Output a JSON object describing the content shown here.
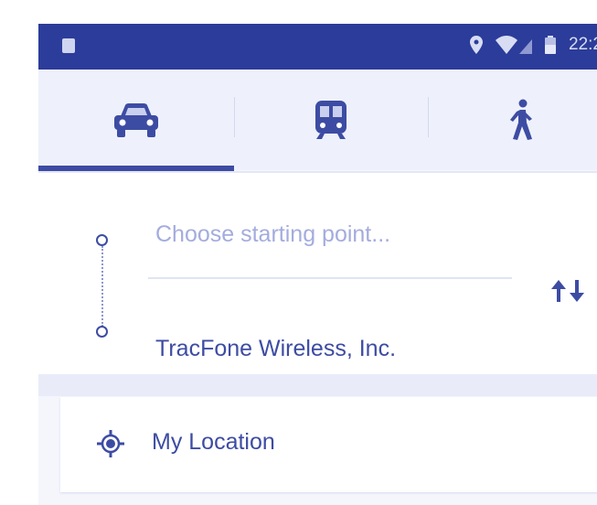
{
  "colors": {
    "accent": "#3d4ca3",
    "status_bar": "#2c3c9a",
    "placeholder": "#a4acde",
    "panel_bg": "#f4f6fc"
  },
  "status_bar": {
    "left_icon": "notification-image-icon",
    "icons": [
      "location-pin-icon",
      "wifi-icon",
      "signal-icon",
      "battery-icon"
    ],
    "time": "22:2"
  },
  "tabs": [
    {
      "icon": "car-icon",
      "mode": "driving",
      "selected": true
    },
    {
      "icon": "train-icon",
      "mode": "transit",
      "selected": false
    },
    {
      "icon": "walk-icon",
      "mode": "walking",
      "selected": false
    }
  ],
  "route": {
    "start_placeholder": "Choose starting point...",
    "destination": "TracFone Wireless, Inc.",
    "swap_icon": "swap-arrows-icon"
  },
  "suggestions": [
    {
      "icon": "my-location-icon",
      "label": "My Location"
    }
  ]
}
